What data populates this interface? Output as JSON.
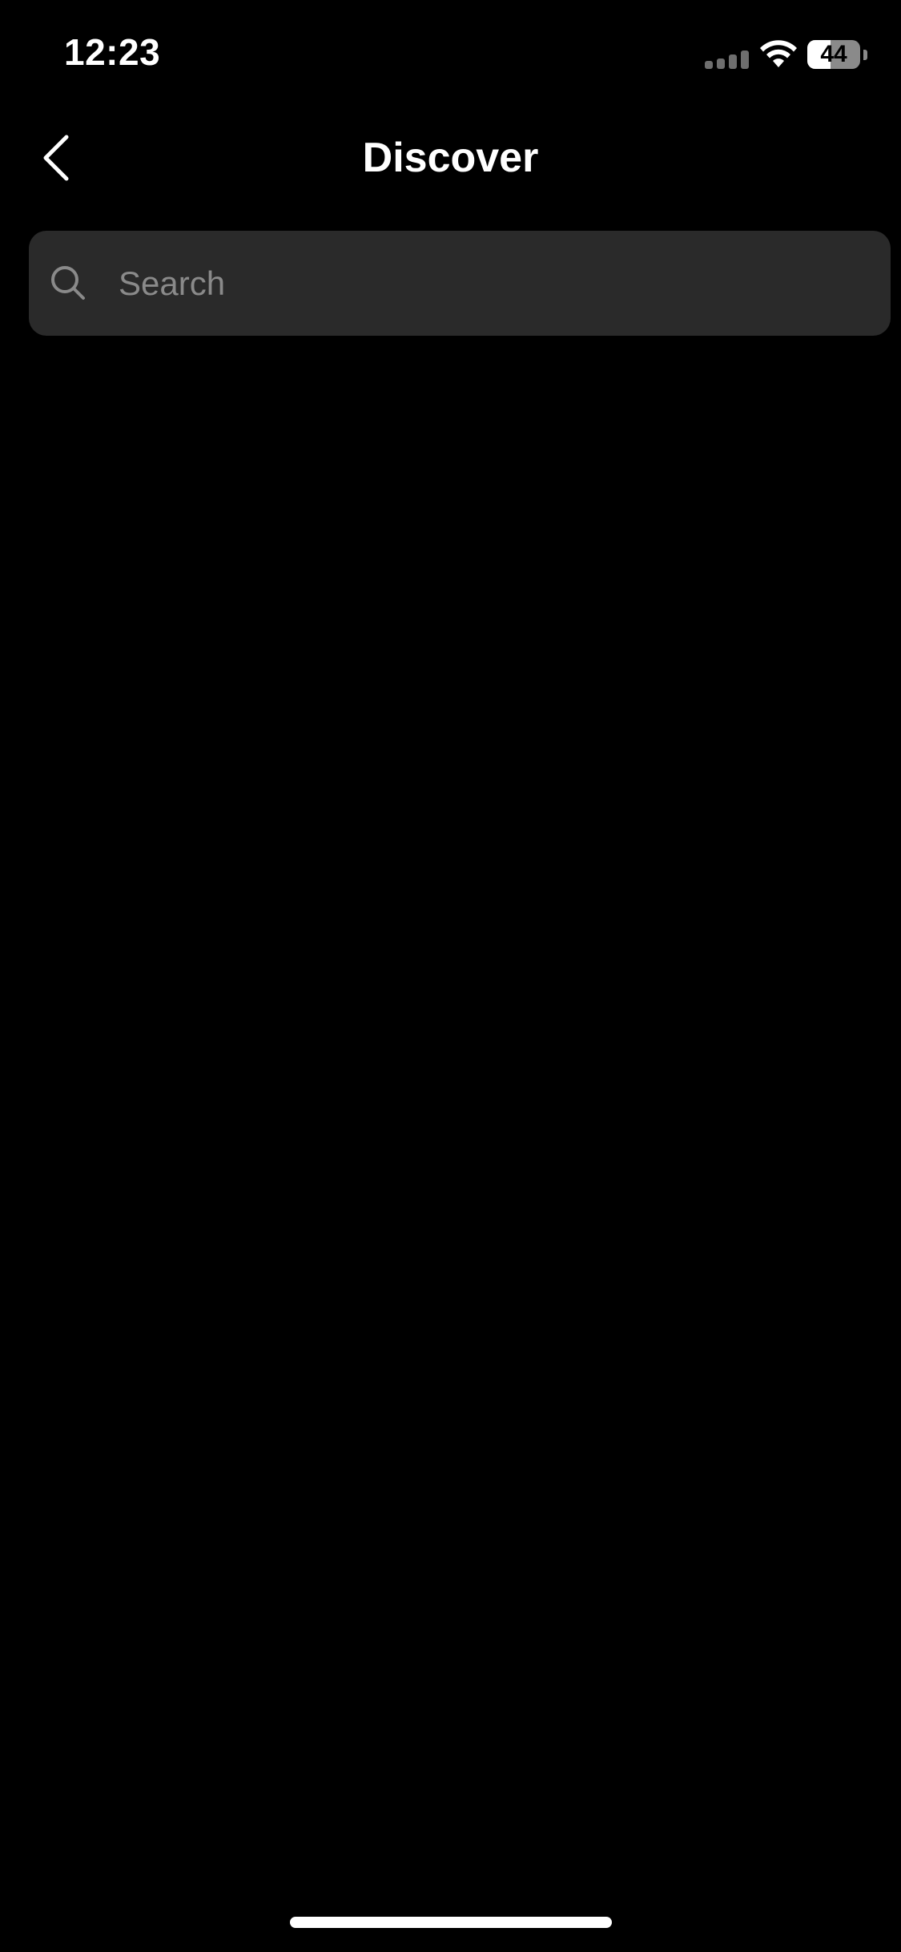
{
  "status_bar": {
    "time": "12:23",
    "battery_level": "44",
    "battery_fraction": 0.44
  },
  "header": {
    "title": "Discover",
    "back_icon": "chevron-left-icon"
  },
  "search": {
    "placeholder": "Search",
    "value": "",
    "icon": "search-icon"
  },
  "colors": {
    "background": "#000000",
    "search_bar_bg": "#2a2a2a",
    "placeholder_text": "#8a8a8a",
    "title_text": "#ffffff"
  }
}
